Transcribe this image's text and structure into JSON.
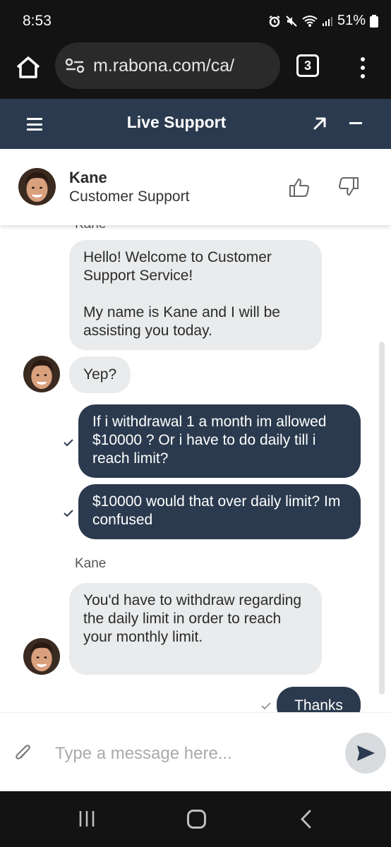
{
  "status_bar": {
    "time": "8:53",
    "battery": "51%"
  },
  "browser": {
    "url": "m.rabona.com/ca/",
    "tab_count": "3"
  },
  "support_header": {
    "title": "Live Support"
  },
  "agent": {
    "name": "Kane",
    "role": "Customer Support"
  },
  "chat": {
    "top_label": "Kane",
    "messages": [
      {
        "from": "agent",
        "text": "Hello! Welcome to Customer Support Service!"
      },
      {
        "from": "agent",
        "text": "My name is Kane and I will be assisting you today."
      },
      {
        "from": "agent",
        "text": "Yep?"
      },
      {
        "from": "user",
        "text": "If i withdrawal 1 a month im allowed $10000 ? Or i have to do daily till i reach limit?"
      },
      {
        "from": "user",
        "text": "$10000 would that over daily limit? Im confused"
      },
      {
        "from": "agent_label",
        "text": "Kane"
      },
      {
        "from": "agent",
        "text": "You'd have to withdraw regarding the daily limit in order to reach your monthly limit."
      },
      {
        "from": "user",
        "text": "Thanks"
      }
    ]
  },
  "composer": {
    "placeholder": "Type a message here..."
  },
  "colors": {
    "header": "#2b3a4e",
    "user_bubble": "#2b3a4e",
    "agent_bubble": "#e9ebec"
  }
}
